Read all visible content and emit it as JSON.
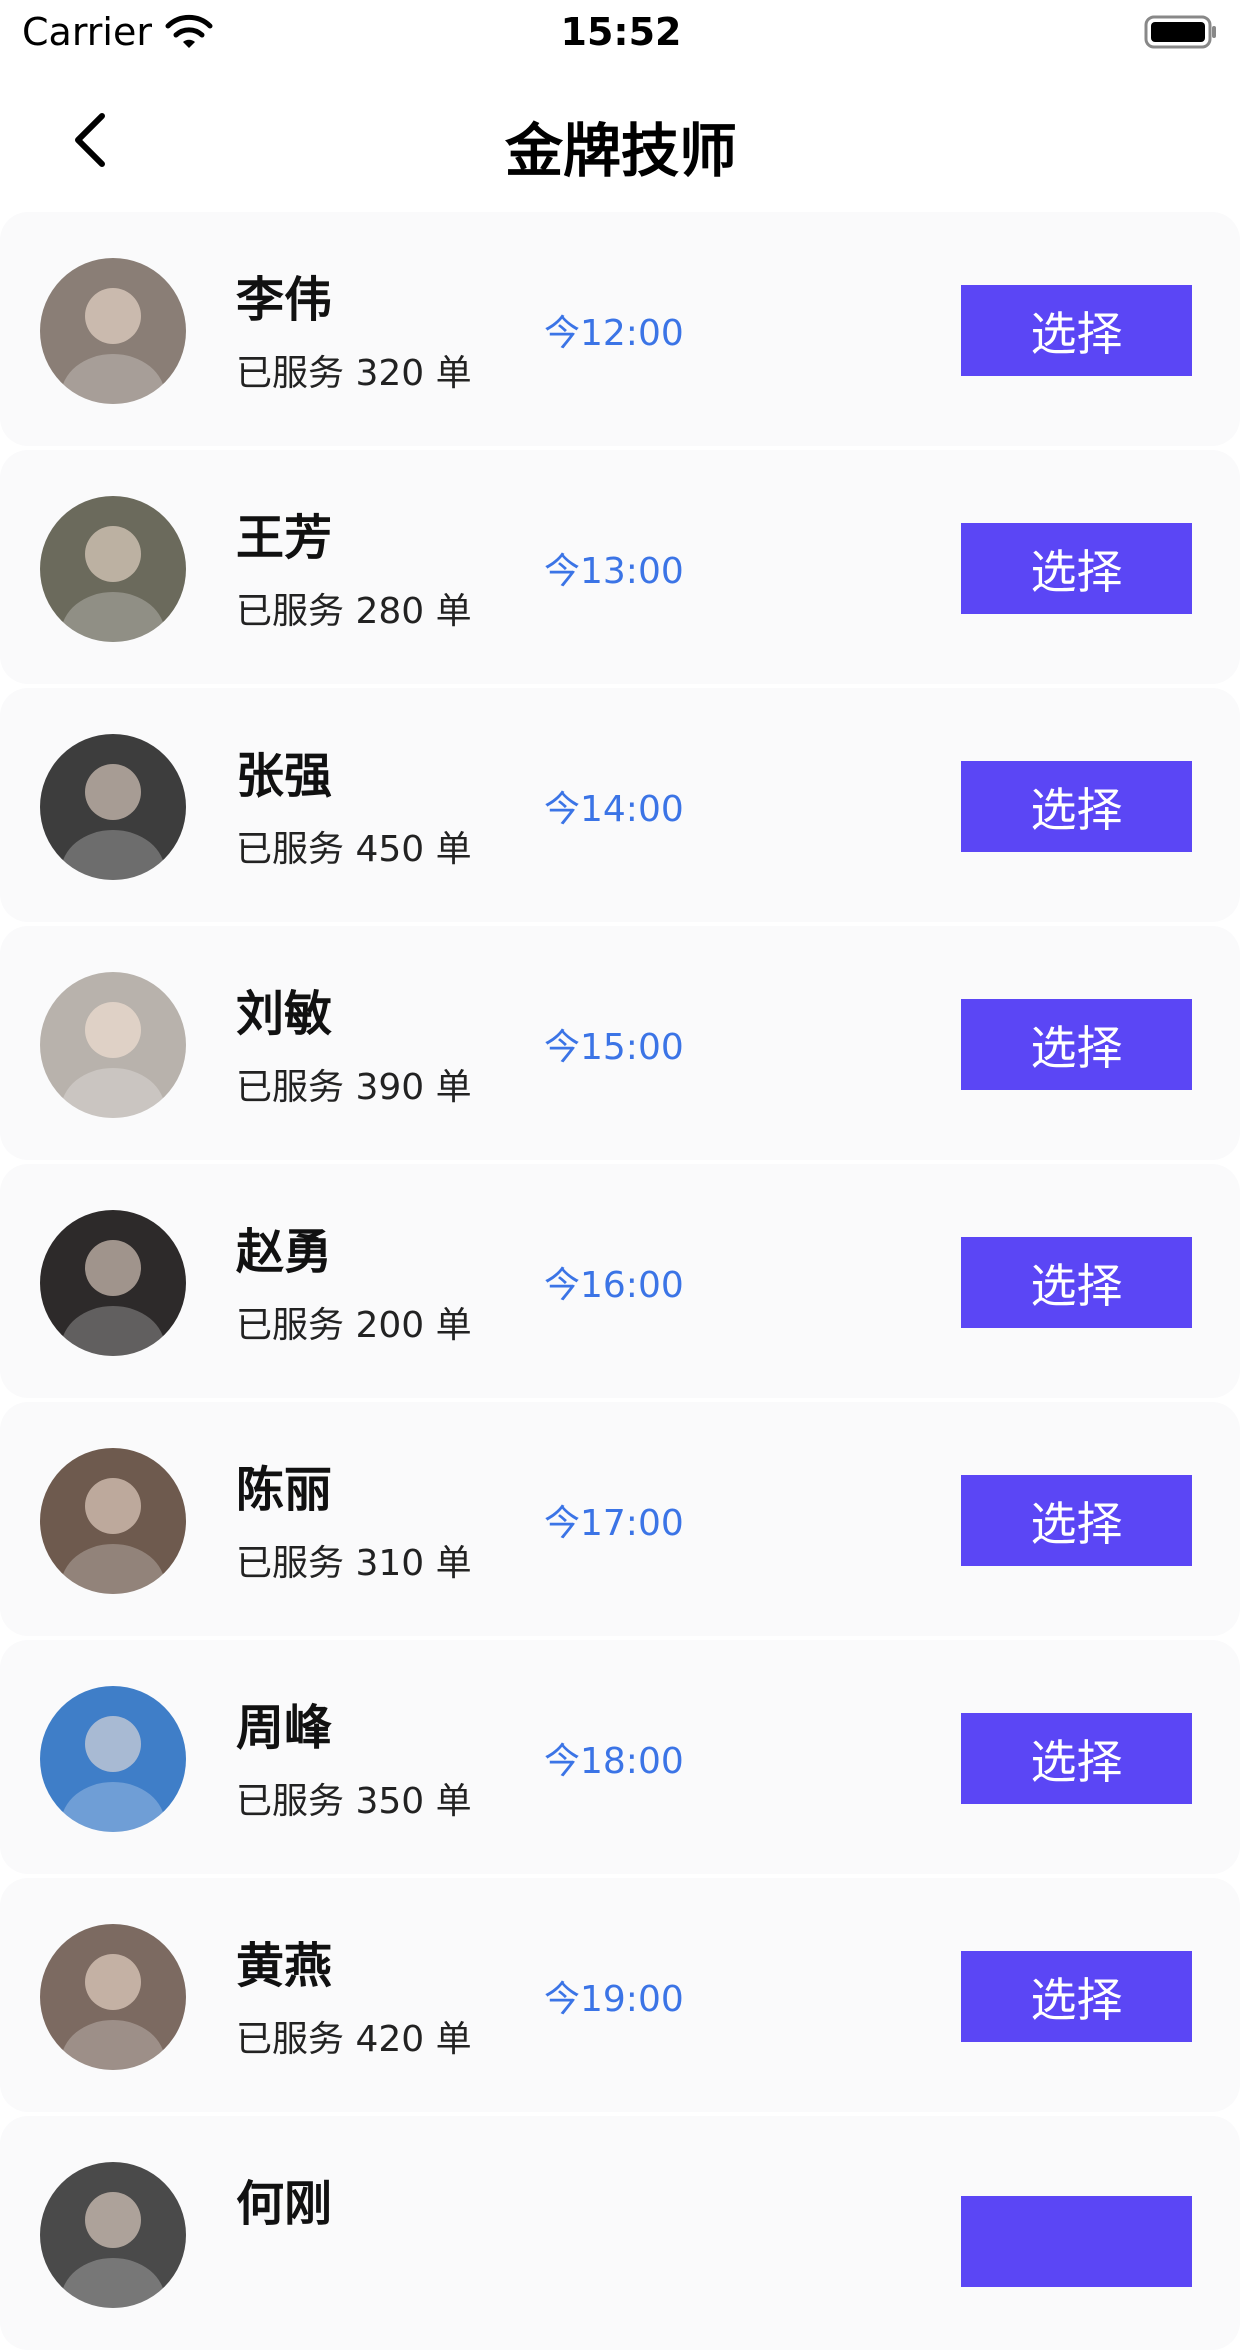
{
  "status_bar": {
    "carrier": "Carrier",
    "time": "15:52"
  },
  "nav": {
    "title": "金牌技师",
    "back_icon": "chevron-left-icon"
  },
  "colors": {
    "accent": "#5b46f5",
    "time_text": "#3b74e6",
    "card_bg": "#fafafb"
  },
  "technicians": [
    {
      "name": "李伟",
      "served": "已服务 320 单",
      "time": "今12:00",
      "button": "选择",
      "avatar_color": "#8a7e76"
    },
    {
      "name": "王芳",
      "served": "已服务 280 单",
      "time": "今13:00",
      "button": "选择",
      "avatar_color": "#6b6a5c"
    },
    {
      "name": "张强",
      "served": "已服务 450 单",
      "time": "今14:00",
      "button": "选择",
      "avatar_color": "#3d3d3d"
    },
    {
      "name": "刘敏",
      "served": "已服务 390 单",
      "time": "今15:00",
      "button": "选择",
      "avatar_color": "#b8b2ac"
    },
    {
      "name": "赵勇",
      "served": "已服务 200 单",
      "time": "今16:00",
      "button": "选择",
      "avatar_color": "#2d2a2a"
    },
    {
      "name": "陈丽",
      "served": "已服务 310 单",
      "time": "今17:00",
      "button": "选择",
      "avatar_color": "#6e5a4e"
    },
    {
      "name": "周峰",
      "served": "已服务 350 单",
      "time": "今18:00",
      "button": "选择",
      "avatar_color": "#3f7ec8"
    },
    {
      "name": "黄燕",
      "served": "已服务 420 单",
      "time": "今19:00",
      "button": "选择",
      "avatar_color": "#7c6a61"
    },
    {
      "name": "何刚",
      "served": "",
      "time": "",
      "button": "",
      "avatar_color": "#4a4a4a"
    }
  ]
}
